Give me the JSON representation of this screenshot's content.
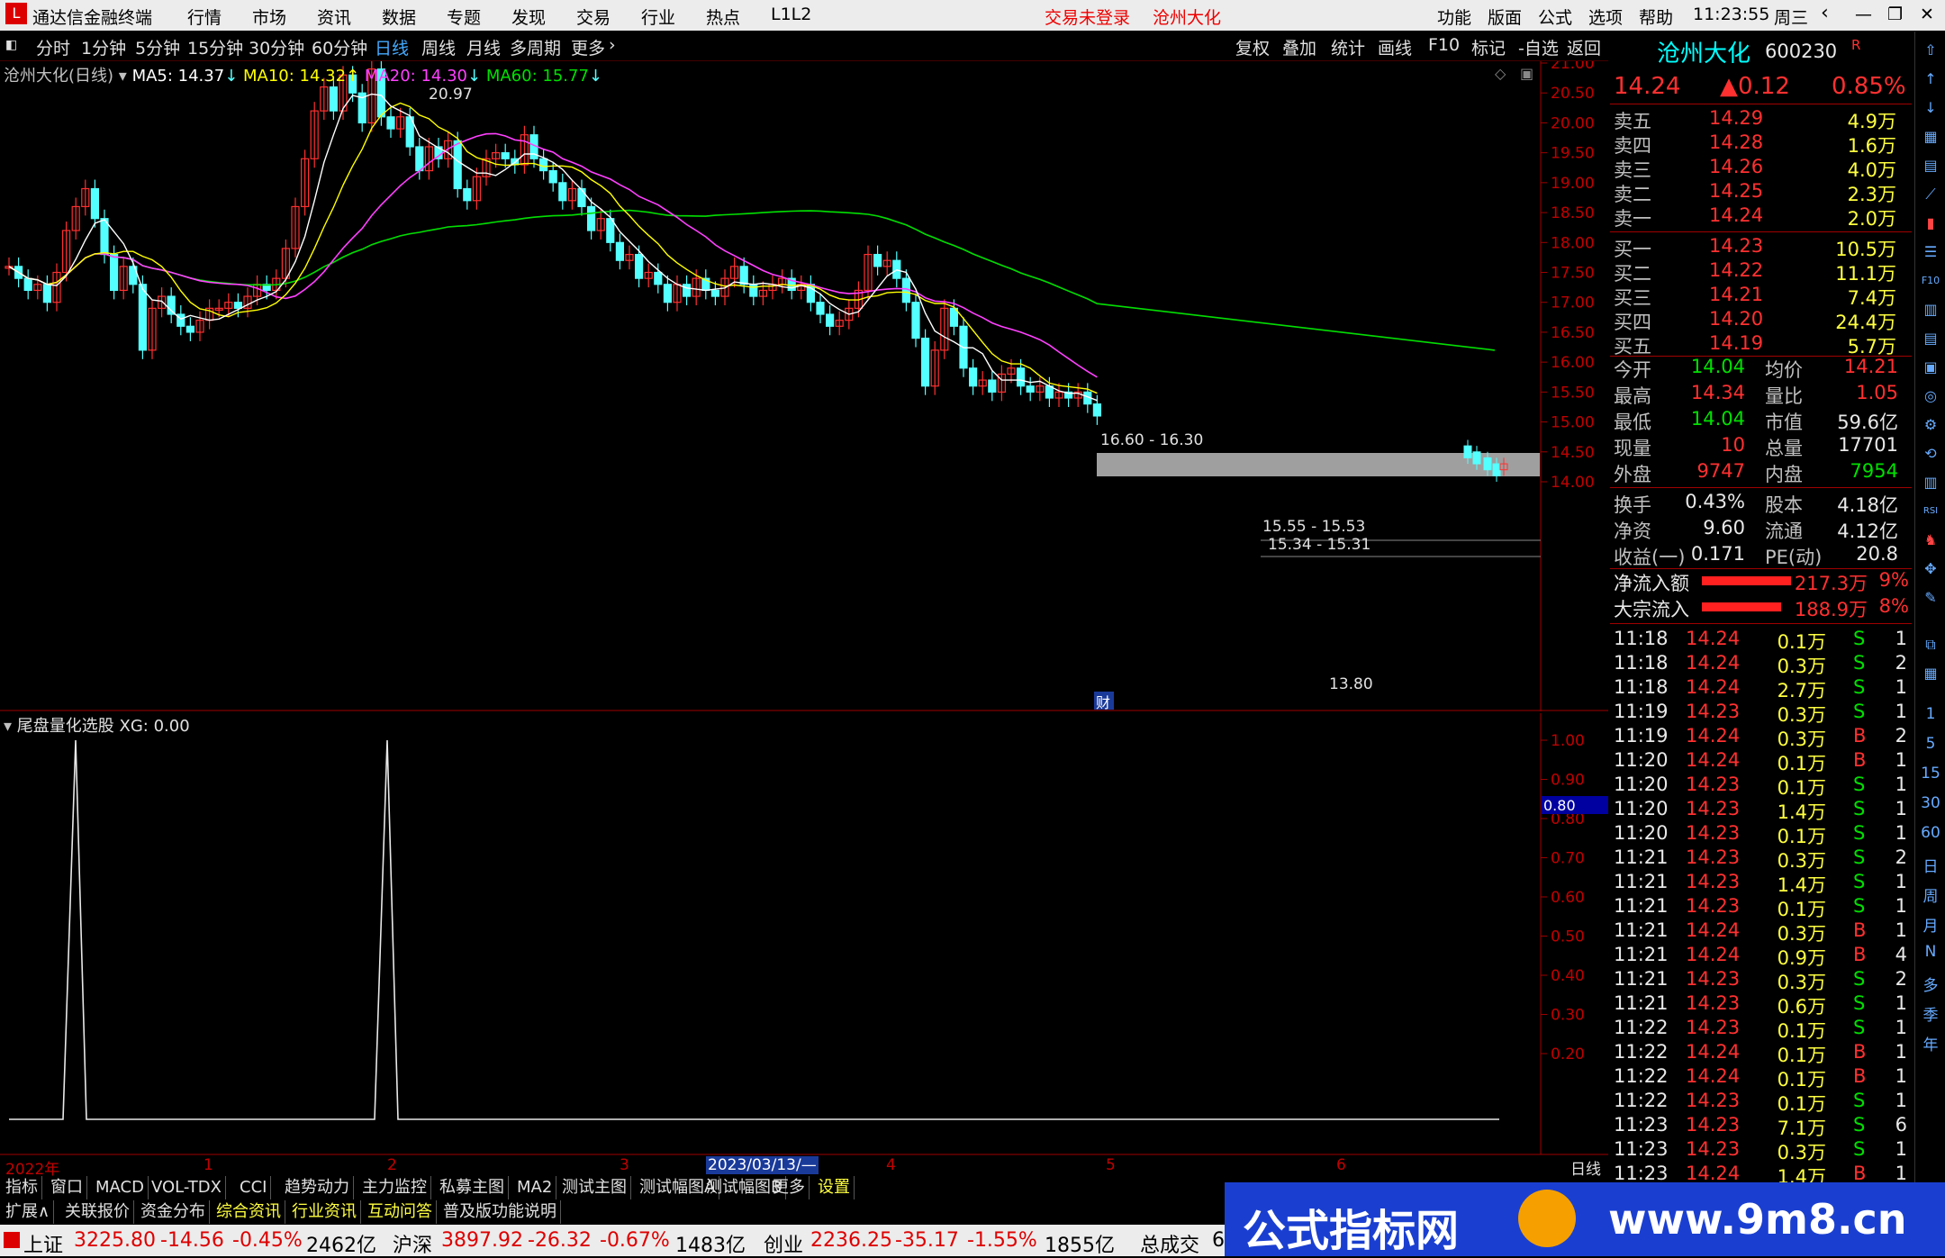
{
  "app": {
    "title": "通达信金融终端",
    "menu": [
      "行情",
      "市场",
      "资讯",
      "数据",
      "专题",
      "发现",
      "交易",
      "行业",
      "热点",
      "L1L2"
    ],
    "login_status": "交易未登录",
    "stock_name_title": "沧州大化",
    "right_menu": [
      "功能",
      "版面",
      "公式",
      "选项",
      "帮助"
    ],
    "time": "11:23:55",
    "weekday": "周三"
  },
  "toolbar": {
    "periods": [
      "分时",
      "1分钟",
      "5分钟",
      "15分钟",
      "30分钟",
      "60分钟",
      "日线",
      "周线",
      "月线",
      "多周期",
      "更多"
    ],
    "selected": "日线",
    "actions": [
      "复权",
      "叠加",
      "统计",
      "画线",
      "F10",
      "标记",
      "-自选",
      "返回"
    ]
  },
  "main_chart": {
    "title": "沧州大化(日线)",
    "ma5": "MA5: 14.37",
    "ma10": "MA10: 14.32",
    "ma20": "MA20: 14.30",
    "ma60": "MA60: 15.77",
    "high_label": "20.97",
    "low_label": "13.80",
    "gap1": "16.60 - 16.30",
    "gap2": "15.55 - 15.53",
    "gap3": "15.34 - 15.31",
    "fin_marker": "财",
    "y_ticks": [
      "21.00",
      "20.50",
      "20.00",
      "19.50",
      "19.00",
      "18.50",
      "18.00",
      "17.50",
      "17.00",
      "16.50",
      "16.00",
      "15.50",
      "15.00",
      "14.50",
      "14.00"
    ]
  },
  "sub_chart": {
    "title": "尾盘量化选股",
    "value": "XG: 0.00",
    "y_ticks": [
      "1.00",
      "0.90",
      "0.80",
      "0.70",
      "0.60",
      "0.50",
      "0.40",
      "0.30",
      "0.20"
    ],
    "current": "0.80"
  },
  "x_axis": {
    "labels": [
      "2022年",
      "1",
      "2",
      "3",
      "4",
      "5",
      "6"
    ],
    "cursor_date": "2023/03/13/—",
    "period": "日线"
  },
  "colors": {
    "ma5": "#ffffff",
    "ma10": "#ffff00",
    "ma20": "#ff40ff",
    "ma60": "#00e000",
    "up": "#ff3030",
    "down": "#54ffff"
  },
  "quote": {
    "name": "沧州大化",
    "code": "600230",
    "tag": "R",
    "price": "14.24",
    "change": "▲0.12",
    "pct": "0.85%",
    "asks": [
      {
        "label": "卖五",
        "price": "14.29",
        "vol": "4.9万"
      },
      {
        "label": "卖四",
        "price": "14.28",
        "vol": "1.6万"
      },
      {
        "label": "卖三",
        "price": "14.26",
        "vol": "4.0万"
      },
      {
        "label": "卖二",
        "price": "14.25",
        "vol": "2.3万"
      },
      {
        "label": "卖一",
        "price": "14.24",
        "vol": "2.0万"
      }
    ],
    "bids": [
      {
        "label": "买一",
        "price": "14.23",
        "vol": "10.5万"
      },
      {
        "label": "买二",
        "price": "14.22",
        "vol": "11.1万"
      },
      {
        "label": "买三",
        "price": "14.21",
        "vol": "7.4万"
      },
      {
        "label": "买四",
        "price": "14.20",
        "vol": "24.4万"
      },
      {
        "label": "买五",
        "price": "14.19",
        "vol": "5.7万"
      }
    ],
    "stats": [
      {
        "l1": "今开",
        "v1": "14.04",
        "l2": "均价",
        "v2": "14.21"
      },
      {
        "l1": "最高",
        "v1": "14.34",
        "l2": "量比",
        "v2": "1.05"
      },
      {
        "l1": "最低",
        "v1": "14.04",
        "l2": "市值",
        "v2": "59.6亿"
      },
      {
        "l1": "现量",
        "v1": "10",
        "l2": "总量",
        "v2": "17701"
      },
      {
        "l1": "外盘",
        "v1": "9747",
        "l2": "内盘",
        "v2": "7954"
      }
    ],
    "fund": [
      {
        "l1": "换手",
        "v1": "0.43%",
        "l2": "股本",
        "v2": "4.18亿"
      },
      {
        "l1": "净资",
        "v1": "9.60",
        "l2": "流通",
        "v2": "4.12亿"
      },
      {
        "l1": "收益(一)",
        "v1": "0.171",
        "l2": "PE(动)",
        "v2": "20.8"
      }
    ],
    "flow": [
      {
        "label": "净流入额",
        "value": "217.3万",
        "pct": "9%",
        "fill": 0.9
      },
      {
        "label": "大宗流入",
        "value": "188.9万",
        "pct": "8%",
        "fill": 0.8
      }
    ],
    "ticks": [
      {
        "t": "11:18",
        "p": "14.24",
        "v": "0.1万",
        "d": "S",
        "n": "1"
      },
      {
        "t": "11:18",
        "p": "14.24",
        "v": "0.3万",
        "d": "S",
        "n": "2"
      },
      {
        "t": "11:18",
        "p": "14.24",
        "v": "2.7万",
        "d": "S",
        "n": "1"
      },
      {
        "t": "11:19",
        "p": "14.23",
        "v": "0.3万",
        "d": "S",
        "n": "1"
      },
      {
        "t": "11:19",
        "p": "14.24",
        "v": "0.3万",
        "d": "B",
        "n": "2"
      },
      {
        "t": "11:20",
        "p": "14.24",
        "v": "0.1万",
        "d": "B",
        "n": "1"
      },
      {
        "t": "11:20",
        "p": "14.23",
        "v": "0.1万",
        "d": "S",
        "n": "1"
      },
      {
        "t": "11:20",
        "p": "14.23",
        "v": "1.4万",
        "d": "S",
        "n": "1"
      },
      {
        "t": "11:20",
        "p": "14.23",
        "v": "0.1万",
        "d": "S",
        "n": "1"
      },
      {
        "t": "11:21",
        "p": "14.23",
        "v": "0.3万",
        "d": "S",
        "n": "2"
      },
      {
        "t": "11:21",
        "p": "14.23",
        "v": "1.4万",
        "d": "S",
        "n": "1"
      },
      {
        "t": "11:21",
        "p": "14.23",
        "v": "0.1万",
        "d": "S",
        "n": "1"
      },
      {
        "t": "11:21",
        "p": "14.24",
        "v": "0.3万",
        "d": "B",
        "n": "1"
      },
      {
        "t": "11:21",
        "p": "14.24",
        "v": "0.9万",
        "d": "B",
        "n": "4"
      },
      {
        "t": "11:21",
        "p": "14.23",
        "v": "0.3万",
        "d": "S",
        "n": "2"
      },
      {
        "t": "11:21",
        "p": "14.23",
        "v": "0.6万",
        "d": "S",
        "n": "1"
      },
      {
        "t": "11:22",
        "p": "14.23",
        "v": "0.1万",
        "d": "S",
        "n": "1"
      },
      {
        "t": "11:22",
        "p": "14.24",
        "v": "0.1万",
        "d": "B",
        "n": "1"
      },
      {
        "t": "11:22",
        "p": "14.24",
        "v": "0.1万",
        "d": "B",
        "n": "1"
      },
      {
        "t": "11:22",
        "p": "14.23",
        "v": "0.1万",
        "d": "S",
        "n": "1"
      },
      {
        "t": "11:23",
        "p": "14.23",
        "v": "7.1万",
        "d": "S",
        "n": "6"
      },
      {
        "t": "11:23",
        "p": "14.23",
        "v": "0.3万",
        "d": "S",
        "n": "1"
      },
      {
        "t": "11:23",
        "p": "14.24",
        "v": "1.4万",
        "d": "B",
        "n": "1"
      }
    ]
  },
  "sidebar_periods": [
    "1",
    "5",
    "15",
    "30",
    "60",
    "日",
    "周",
    "月",
    "N",
    "多",
    "季",
    "年"
  ],
  "tabs1": [
    "指标",
    "窗口",
    "MACD",
    "VOL-TDX",
    "CCI",
    "趋势动力",
    "主力监控",
    "私募主图",
    "MA2",
    "测试主图",
    "测试幅图A",
    "测试幅图B",
    "更多",
    "设置"
  ],
  "tabs2": [
    "扩展∧",
    "关联报价",
    "资金分布",
    "综合资讯",
    "行业资讯",
    "互动问答",
    "普及版功能说明"
  ],
  "status": {
    "sh_name": "上证",
    "sh_val": "3225.80",
    "sh_chg": "-14.56",
    "sh_pct": "-0.45%",
    "sh_amt": "2462亿",
    "hs_name": "沪深",
    "hs_val": "3897.92",
    "hs_chg": "-26.32",
    "hs_pct": "-0.67%",
    "hs_amt": "1483亿",
    "cy_name": "创业",
    "cy_val": "2236.25",
    "cy_chg": "-35.17",
    "cy_pct": "-1.55%",
    "cy_amt": "1855亿",
    "total_label": "总成交",
    "total_val": "6"
  },
  "banner": {
    "text": "公式指标网",
    "url": "www.9m8.cn"
  }
}
